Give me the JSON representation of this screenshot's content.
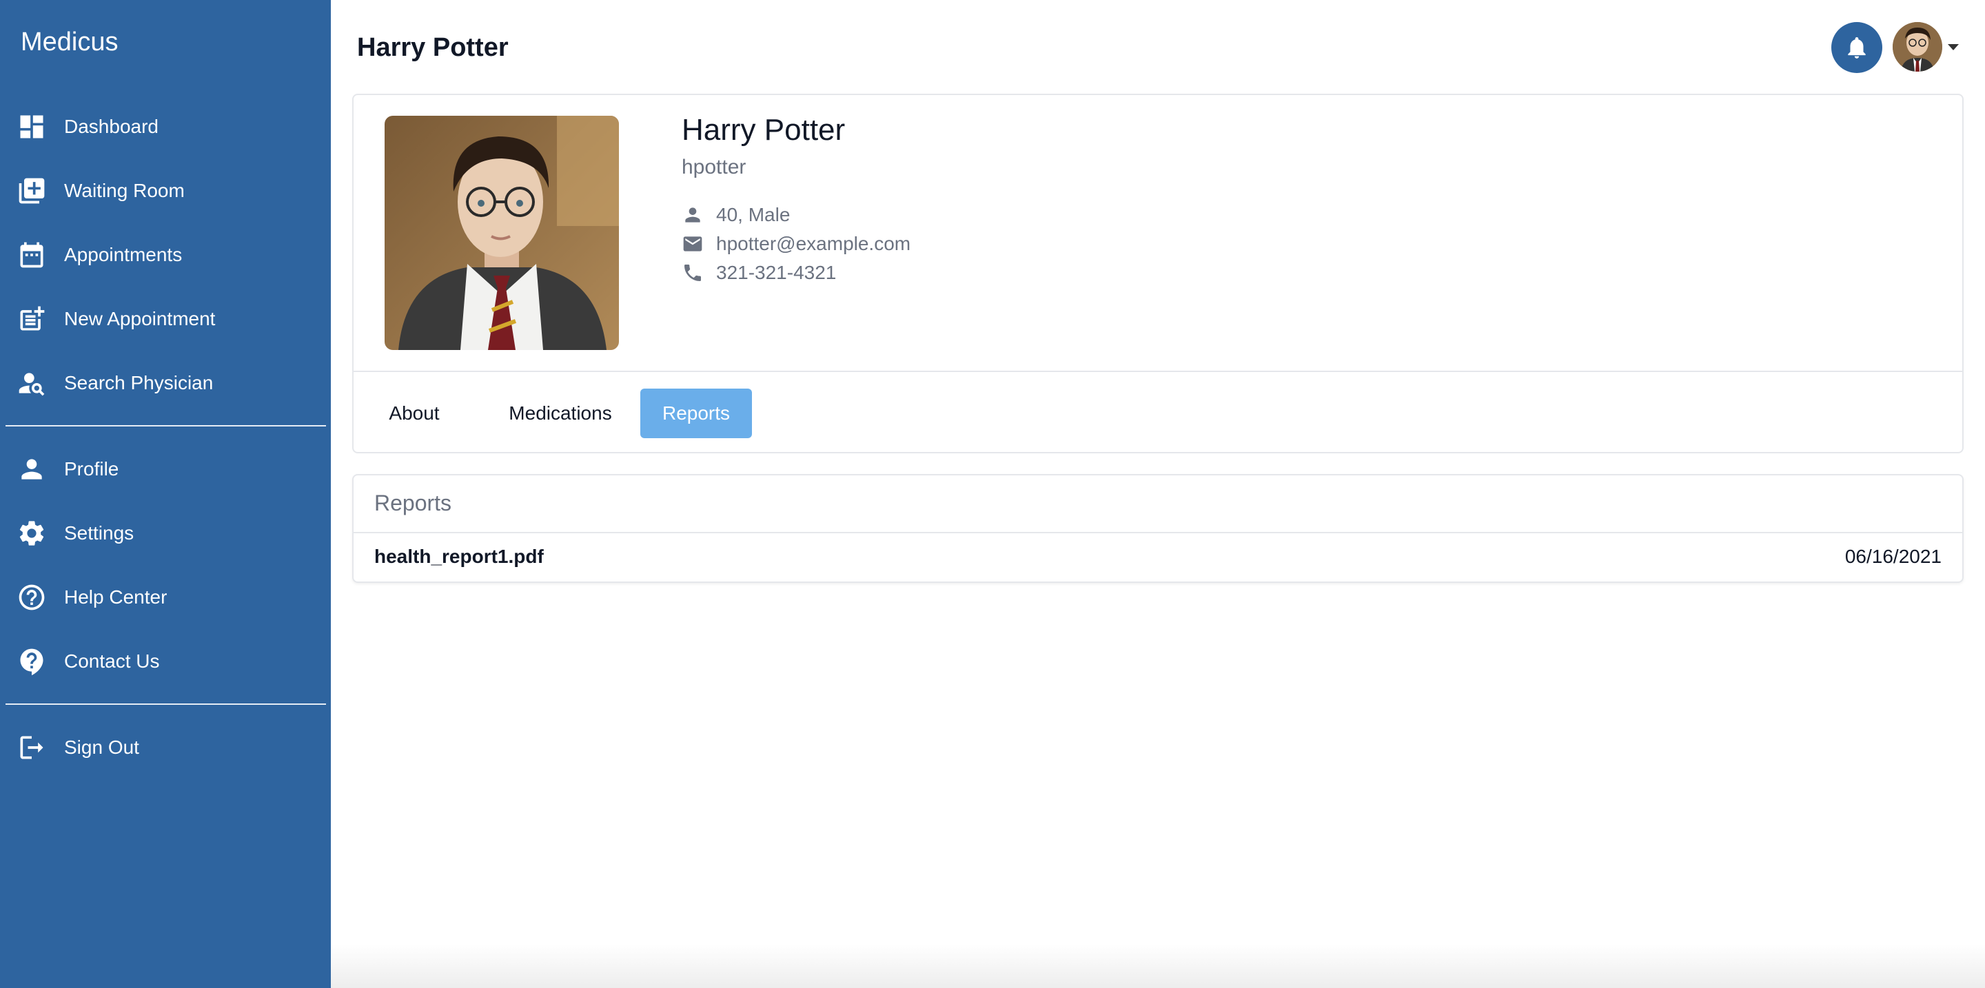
{
  "sidebar": {
    "brand": "Medicus",
    "items": [
      {
        "label": "Dashboard",
        "icon": "dashboard-icon"
      },
      {
        "label": "Waiting Room",
        "icon": "add-box-icon"
      },
      {
        "label": "Appointments",
        "icon": "calendar-icon"
      },
      {
        "label": "New Appointment",
        "icon": "post-add-icon"
      },
      {
        "label": "Search Physician",
        "icon": "person-search-icon"
      },
      {
        "label": "Profile",
        "icon": "person-icon"
      },
      {
        "label": "Settings",
        "icon": "gear-icon"
      },
      {
        "label": "Help Center",
        "icon": "help-circle-icon"
      },
      {
        "label": "Contact Us",
        "icon": "contact-help-icon"
      },
      {
        "label": "Sign Out",
        "icon": "sign-out-icon"
      }
    ]
  },
  "header": {
    "title": "Harry Potter",
    "bell_icon": "bell-icon",
    "avatar_icon": "user-avatar"
  },
  "profile": {
    "name": "Harry Potter",
    "username": "hpotter",
    "age_gender": "40, Male",
    "email": "hpotter@example.com",
    "phone": "321-321-4321"
  },
  "tabs": [
    {
      "label": "About",
      "active": false
    },
    {
      "label": "Medications",
      "active": false
    },
    {
      "label": "Reports",
      "active": true
    }
  ],
  "reports": {
    "title": "Reports",
    "items": [
      {
        "name": "health_report1.pdf",
        "date": "06/16/2021"
      }
    ]
  },
  "colors": {
    "sidebar": "#2e649f",
    "active_tab": "#6aaeea",
    "muted_text": "#6b7280"
  }
}
